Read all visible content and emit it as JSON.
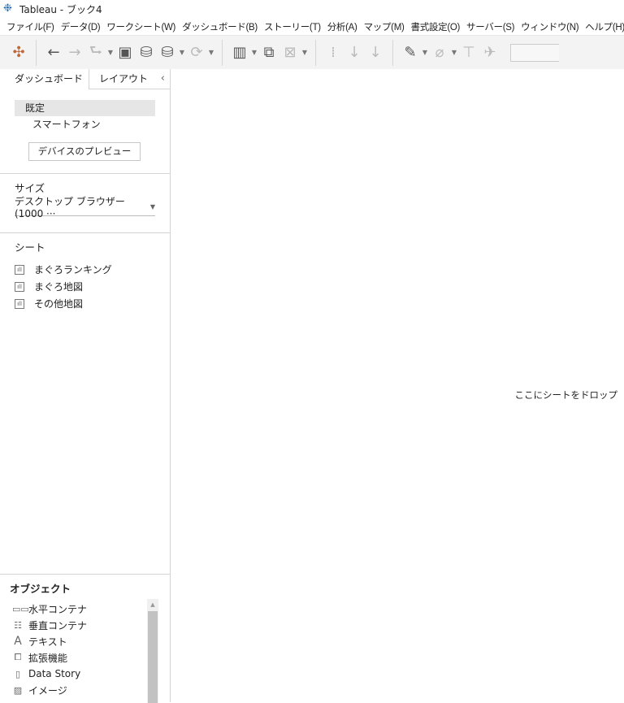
{
  "window": {
    "title": "Tableau - ブック4"
  },
  "menu": [
    "ファイル(F)",
    "データ(D)",
    "ワークシート(W)",
    "ダッシュボード(B)",
    "ストーリー(T)",
    "分析(A)",
    "マップ(M)",
    "書式設定(O)",
    "サーバー(S)",
    "ウィンドウ(N)",
    "ヘルプ(H)"
  ],
  "panel": {
    "tabs": [
      {
        "label": "ダッシュボード",
        "active": true
      },
      {
        "label": "レイアウト",
        "active": false
      }
    ],
    "devices": {
      "default": "既定",
      "phone": "スマートフォン",
      "preview_button": "デバイスのプレビュー"
    },
    "size": {
      "label": "サイズ",
      "value": "デスクトップ ブラウザー (1000 ···"
    },
    "sheets": {
      "label": "シート",
      "items": [
        "まぐろランキング",
        "まぐろ地図",
        "その他地図"
      ]
    },
    "objects": {
      "label": "オブジェクト",
      "items": [
        {
          "icon": "horizontal-container-icon",
          "label": "水平コンテナ"
        },
        {
          "icon": "vertical-container-icon",
          "label": "垂直コンテナ"
        },
        {
          "icon": "text-icon",
          "label": "テキスト"
        },
        {
          "icon": "extension-icon",
          "label": "拡張機能"
        },
        {
          "icon": "data-story-icon",
          "label": "Data Story"
        },
        {
          "icon": "image-icon",
          "label": "イメージ"
        }
      ]
    }
  },
  "canvas": {
    "drop_hint": "ここにシートをドロップ"
  }
}
